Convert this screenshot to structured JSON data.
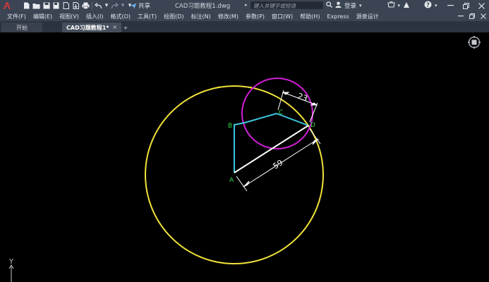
{
  "app": {
    "document_title": "CAD习题教程1.dwg",
    "share_label": "共享",
    "search_placeholder": "键入关键字或短语",
    "login_label": "登录",
    "help_label": "?"
  },
  "menu": {
    "items": [
      "文件(F)",
      "编辑(E)",
      "视图(V)",
      "插入(I)",
      "格式(O)",
      "工具(T)",
      "绘图(D)",
      "标注(N)",
      "修改(M)",
      "参数(P)",
      "窗口(W)",
      "帮助(H)",
      "Express",
      "源泉设计"
    ]
  },
  "tabs": {
    "start_label": "开始",
    "active_label": "CAD习题教程1*",
    "close_glyph": "×",
    "add_glyph": "+"
  },
  "drawing": {
    "points": {
      "A": "A",
      "B": "B",
      "C": "C",
      "D": "D"
    },
    "dimensions": {
      "long": "59",
      "short": "23"
    },
    "ucs_y_label": "Y",
    "colors": {
      "large_circle": "#f2e33a",
      "small_circle": "#d21fd6",
      "polyline": "#3fc6e0",
      "radius_line": "#ffffff",
      "point_labels": "#35d94a",
      "dimension": "#ffffff"
    }
  }
}
